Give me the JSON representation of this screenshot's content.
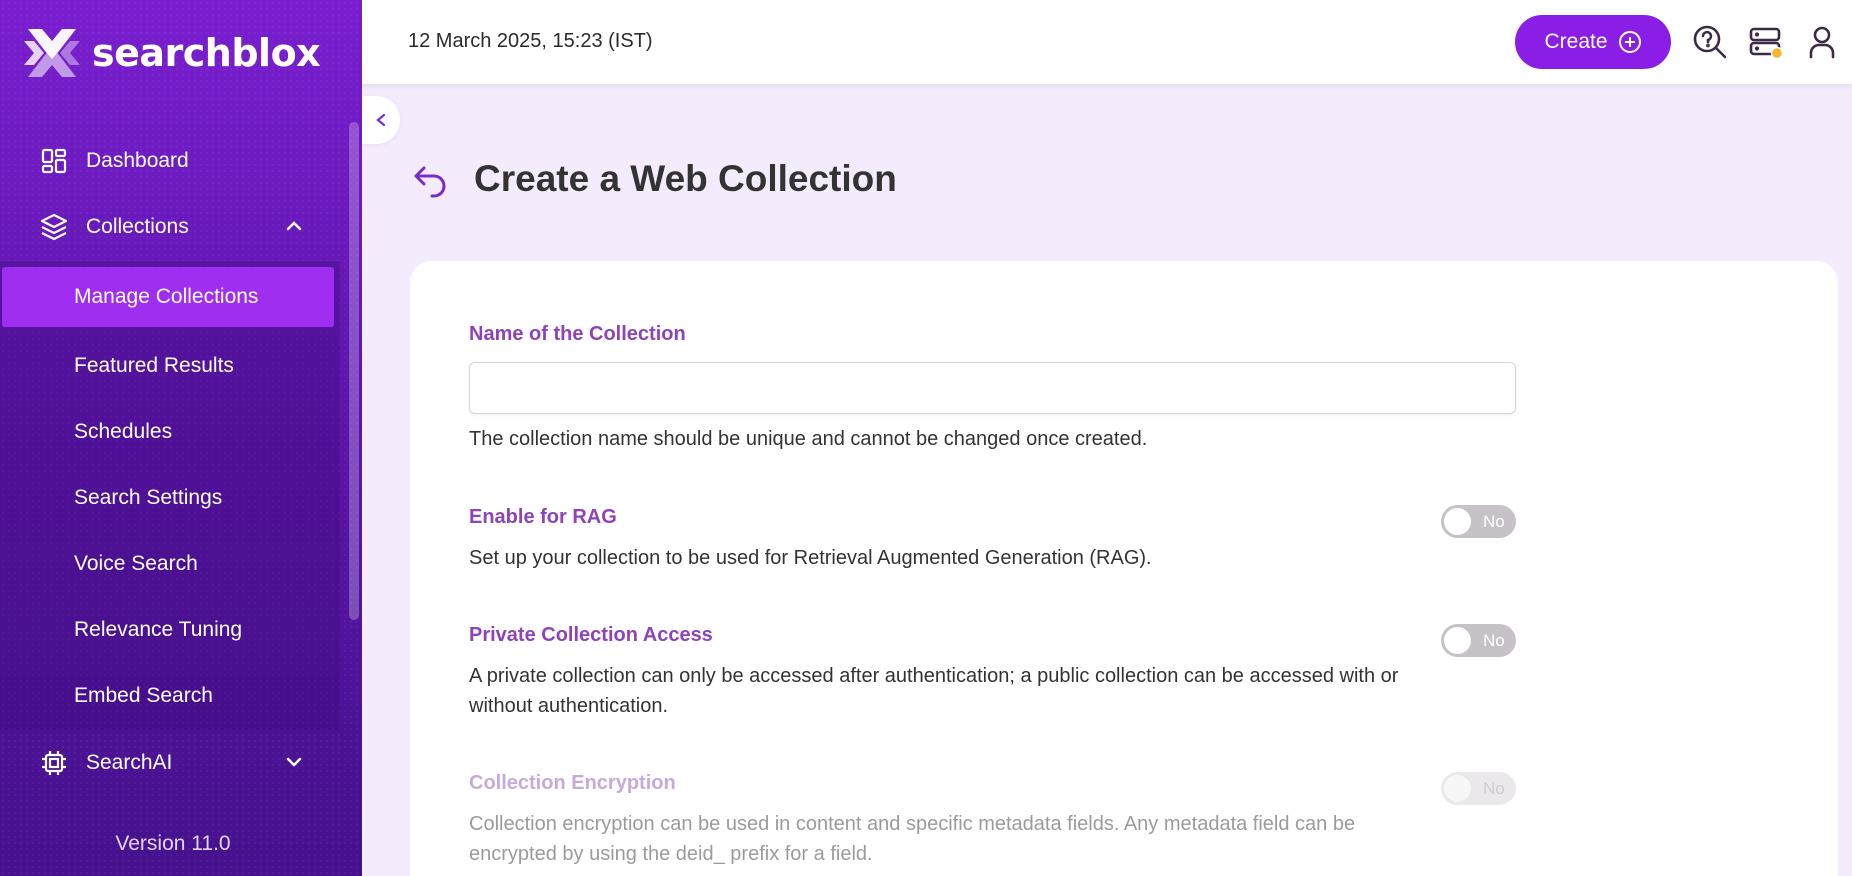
{
  "brand": {
    "name": "searchblox"
  },
  "header": {
    "datetime": "12 March 2025, 15:23 (IST)",
    "create_label": "Create"
  },
  "sidebar": {
    "items": [
      {
        "label": "Dashboard",
        "icon": "dashboard-icon"
      },
      {
        "label": "Collections",
        "icon": "layers-icon",
        "expanded": true
      },
      {
        "label": "SearchAI",
        "icon": "chip-icon",
        "expanded": false
      }
    ],
    "collections_sub": [
      {
        "label": "Manage Collections",
        "active": true
      },
      {
        "label": "Featured Results"
      },
      {
        "label": "Schedules"
      },
      {
        "label": "Search Settings"
      },
      {
        "label": "Voice Search"
      },
      {
        "label": "Relevance Tuning"
      },
      {
        "label": "Embed Search"
      }
    ],
    "version": "Version 11.0"
  },
  "page": {
    "title": "Create a Web Collection",
    "name_label": "Name of the Collection",
    "name_value": "",
    "name_help": "The collection name should be unique and cannot be changed once created.",
    "rag_label": "Enable for RAG",
    "rag_help": "Set up your collection to be used for Retrieval Augmented Generation (RAG).",
    "rag_toggle": "No",
    "private_label": "Private Collection Access",
    "private_help": "A private collection can only be accessed after authentication; a public collection can be accessed with or without authentication.",
    "private_toggle": "No",
    "encryption_label": "Collection Encryption",
    "encryption_help": "Collection encryption can be used in content and specific metadata fields. Any metadata field can be encrypted by using the deid_ prefix for a field.",
    "encryption_toggle": "No"
  },
  "colors": {
    "accent": "#8a1ee6",
    "label": "#8e44b8",
    "notification_dot": "#f5b731"
  }
}
